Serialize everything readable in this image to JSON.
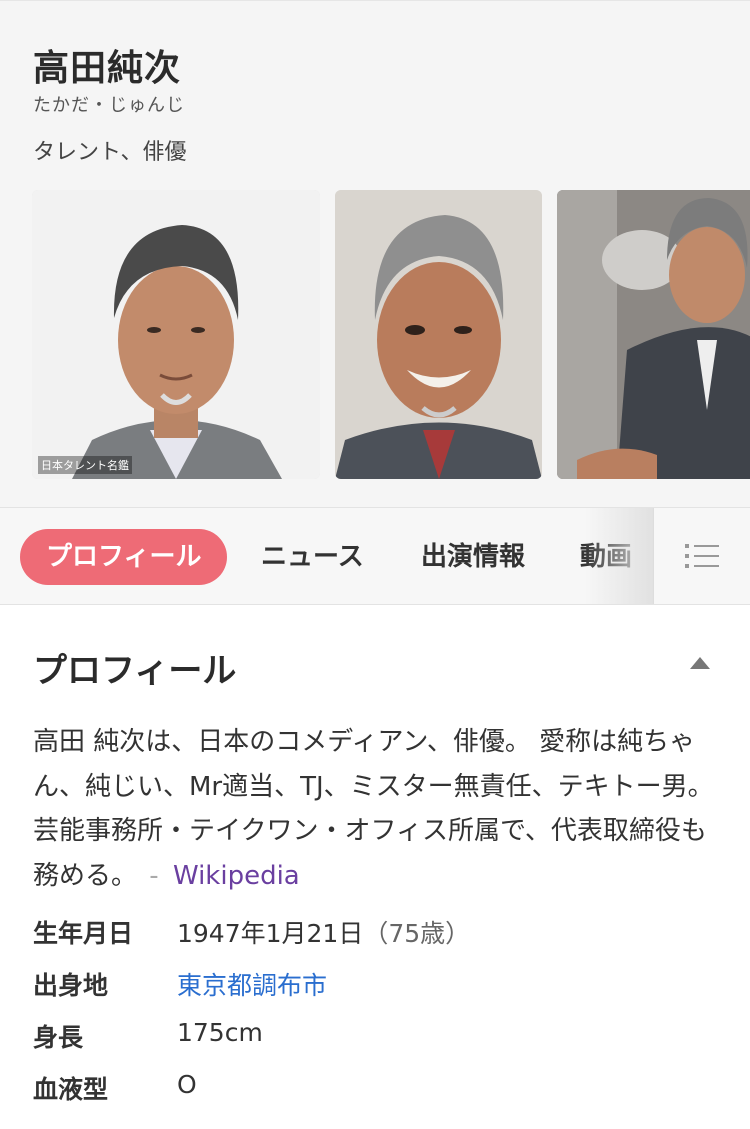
{
  "profile": {
    "name": "高田純次",
    "reading": "たかだ・じゅんじ",
    "occupation": "タレント、俳優",
    "photo_credit": "日本タレント名鑑"
  },
  "tabs": [
    {
      "label": "プロフィール",
      "active": true
    },
    {
      "label": "ニュース",
      "active": false
    },
    {
      "label": "出演情報",
      "active": false
    },
    {
      "label": "動画",
      "active": false
    }
  ],
  "section": {
    "title": "プロフィール",
    "description": "高田 純次は、日本のコメディアン、俳優。 愛称は純ちゃん、純じい、Mr適当、TJ、ミスター無責任、テキトー男。 芸能事務所・テイクワン・オフィス所属で、代表取締役も務める。",
    "source_sep": "-",
    "source_label": "Wikipedia"
  },
  "facts": {
    "birth": {
      "label": "生年月日",
      "value": "1947年1月21日",
      "age": "（75歳）"
    },
    "birthplace": {
      "label": "出身地",
      "value": "東京都調布市"
    },
    "height": {
      "label": "身長",
      "value": "175cm"
    },
    "blood": {
      "label": "血液型",
      "value": "O"
    }
  },
  "colors": {
    "accent": "#ee6b76",
    "link": "#2a6ecf",
    "visited_link": "#6a3fa0"
  },
  "icons": {
    "menu": "list-icon",
    "collapse": "triangle-up-icon"
  }
}
